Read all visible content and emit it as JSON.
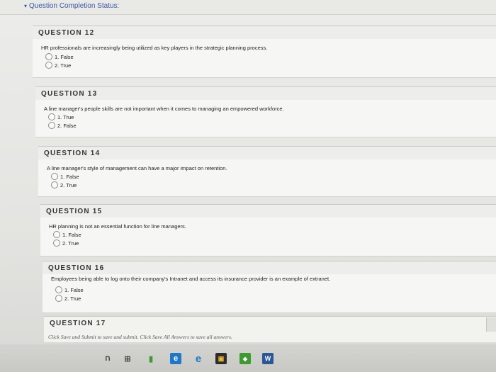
{
  "status_bar": {
    "label": "Question Completion Status:",
    "toggle_icon": "triangle-down-icon"
  },
  "questions": [
    {
      "header": "QUESTION 12",
      "text": "HR professionals are increasingly being utilized as key players in the strategic planning process.",
      "options": [
        "1. False",
        "2. True"
      ]
    },
    {
      "header": "QUESTION 13",
      "text": "A line manager's people skills are not important when it comes to managing an empowered workforce.",
      "options": [
        "1. True",
        "2. False"
      ]
    },
    {
      "header": "QUESTION 14",
      "text": "A line manager's style of management can have a major impact on retention.",
      "options": [
        "1. False",
        "2. True"
      ]
    },
    {
      "header": "QUESTION 15",
      "text": "HR planning is not an essential function for line managers.",
      "options": [
        "1. False",
        "2. True"
      ]
    },
    {
      "header": "QUESTION 16",
      "text": "Employees being able to log onto their company's Intranet and access its insurance provider is an example of extranet.",
      "options": [
        "1. False",
        "2. True"
      ]
    }
  ],
  "footer": {
    "header": "QUESTION 17",
    "note": "Click Save and Submit to save and submit. Click Save All Answers to save all answers."
  },
  "taskbar": {
    "icons": [
      "search-icon",
      "task-view-icon",
      "file-explorer-icon",
      "edge-icon",
      "internet-explorer-icon",
      "store-icon",
      "photos-icon",
      "word-icon"
    ],
    "glyphs": [
      "ח",
      "⊞",
      "▮",
      "e",
      "e",
      "▣",
      "◆",
      "W"
    ]
  },
  "colors": {
    "link_blue": "#3a56a6",
    "edge_blue": "#1e78c8",
    "word_blue": "#2b5797",
    "green": "#3c9a2e"
  }
}
